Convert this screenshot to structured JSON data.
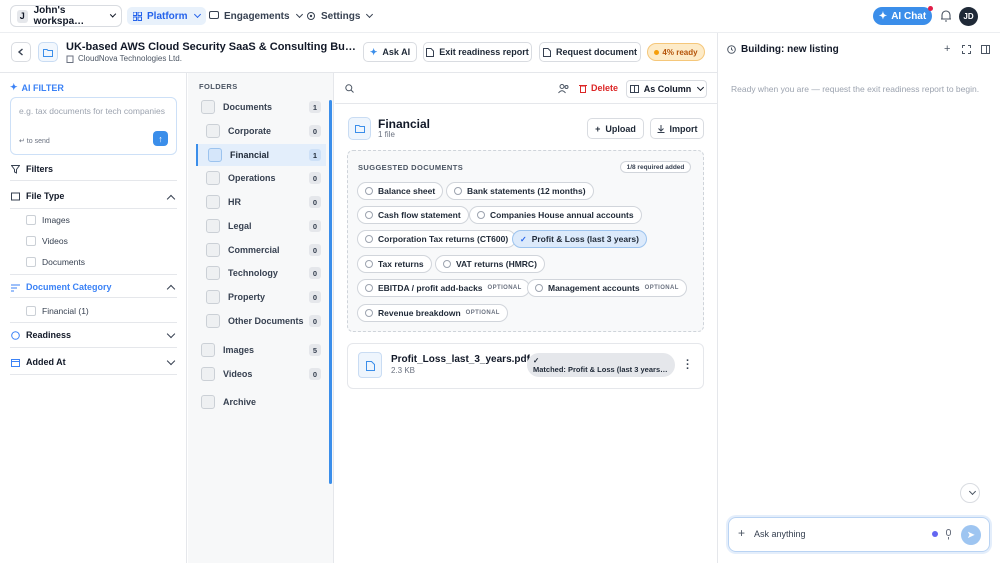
{
  "topbar": {
    "workspace_initial": "J",
    "workspace_name": "John's workspa…",
    "nav": [
      "Platform",
      "Engagements",
      "Settings"
    ],
    "ai_chat_label": "AI Chat",
    "avatar": "JD"
  },
  "header": {
    "title": "UK-based AWS Cloud Security SaaS & Consulting Business …",
    "company": "CloudNova Technologies Ltd.",
    "ask_ai": "Ask AI",
    "exit_report": "Exit readiness report",
    "request_document": "Request document",
    "ready_badge": "4% ready"
  },
  "filter": {
    "ai_filter_label": "AI FILTER",
    "placeholder": "e.g. tax documents for tech companies",
    "send_hint": "↵ to send",
    "filters_label": "Filters",
    "file_type_label": "File Type",
    "file_types": [
      "Images",
      "Videos",
      "Documents"
    ],
    "doc_category_label": "Document Category",
    "doc_categories": [
      "Financial (1)"
    ],
    "readiness_label": "Readiness",
    "added_at_label": "Added At"
  },
  "folders": {
    "heading": "FOLDERS",
    "items": [
      {
        "label": "Documents",
        "count": "1"
      },
      {
        "label": "Corporate",
        "count": "0"
      },
      {
        "label": "Financial",
        "count": "1"
      },
      {
        "label": "Operations",
        "count": "0"
      },
      {
        "label": "HR",
        "count": "0"
      },
      {
        "label": "Legal",
        "count": "0"
      },
      {
        "label": "Commercial",
        "count": "0"
      },
      {
        "label": "Technology",
        "count": "0"
      },
      {
        "label": "Property",
        "count": "0"
      },
      {
        "label": "Other Documents",
        "count": "0"
      },
      {
        "label": "Images",
        "count": "5"
      },
      {
        "label": "Videos",
        "count": "0"
      },
      {
        "label": "Archive",
        "count": ""
      }
    ]
  },
  "main": {
    "delete_label": "Delete",
    "view_label": "As Column",
    "folder_title": "Financial",
    "folder_sub": "1 file",
    "upload_label": "Upload",
    "import_label": "Import",
    "suggested_heading": "SUGGESTED DOCUMENTS",
    "required_badge": "1/8 required added",
    "optional_tag": "OPTIONAL",
    "chips": [
      "Balance sheet",
      "Bank statements (12 months)",
      "Cash flow statement",
      "Companies House annual accounts",
      "Corporation Tax returns (CT600)",
      "Profit & Loss (last 3 years)",
      "Tax returns",
      "VAT returns (HMRC)",
      "EBITDA / profit add-backs",
      "Management accounts",
      "Revenue breakdown"
    ],
    "file": {
      "name": "Profit_Loss_last_3_years.pdf",
      "size": "2.3 KB",
      "match": "Matched: Profit & Loss (last 3 years)…"
    }
  },
  "chat": {
    "title": "Building: new listing",
    "message": "Ready when you are — request the exit readiness report to begin.",
    "placeholder": "Ask anything"
  },
  "colors": {
    "accent": "#3b8eea",
    "danger": "#dc2626",
    "warning": "#f59e0b"
  }
}
